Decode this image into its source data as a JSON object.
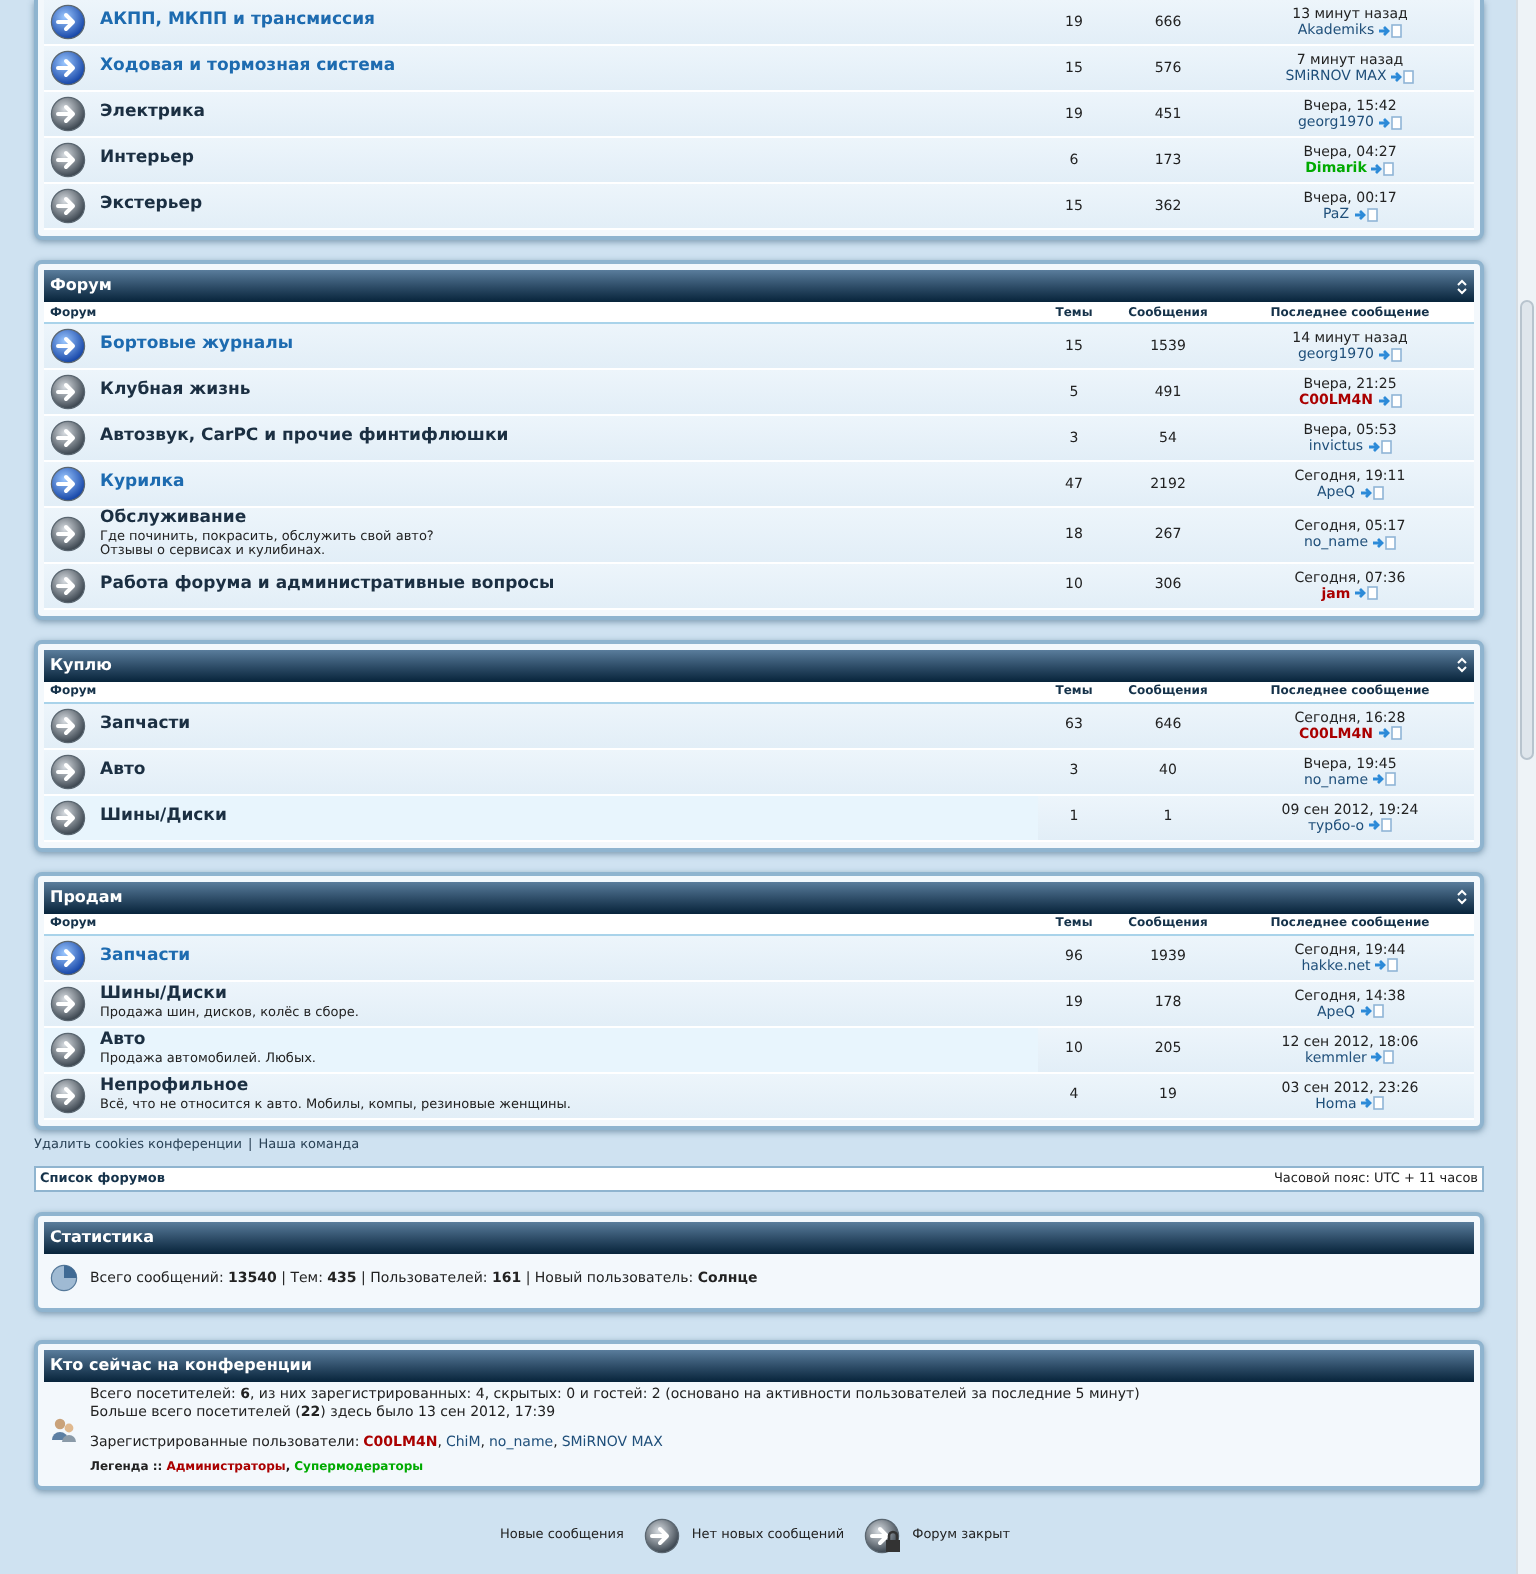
{
  "sections": [
    {
      "forums": [
        {
          "name": "АКПП, МКПП и трансмиссия",
          "unread": true,
          "hovered": false,
          "topics": "19",
          "posts": "666",
          "last_time": "13 минут назад",
          "last_user": {
            "name": "Akademiks",
            "color": "#1f4f7a"
          }
        },
        {
          "name": "Ходовая и тормозная система",
          "unread": true,
          "hovered": false,
          "topics": "15",
          "posts": "576",
          "last_time": "7 минут назад",
          "last_user": {
            "name": "SMiRNOV MAX",
            "color": "#1f4f7a"
          }
        },
        {
          "name": "Электрика",
          "unread": false,
          "hovered": false,
          "topics": "19",
          "posts": "451",
          "last_time": "Вчера, 15:42",
          "last_user": {
            "name": "georg1970",
            "color": "#1f4f7a"
          }
        },
        {
          "name": "Интерьер",
          "unread": false,
          "hovered": false,
          "topics": "6",
          "posts": "173",
          "last_time": "Вчера, 04:27",
          "last_user": {
            "name": "Dimarik",
            "color": "#00aa00"
          }
        },
        {
          "name": "Экстерьер",
          "unread": false,
          "hovered": false,
          "topics": "15",
          "posts": "362",
          "last_time": "Вчера, 00:17",
          "last_user": {
            "name": "PaZ",
            "color": "#1f4f7a"
          }
        }
      ]
    },
    {
      "title": "Форум",
      "columns": [
        "Форум",
        "Темы",
        "Сообщения",
        "Последнее сообщение"
      ],
      "forums": [
        {
          "name": "Бортовые журналы",
          "unread": true,
          "hovered": false,
          "topics": "15",
          "posts": "1539",
          "last_time": "14 минут назад",
          "last_user": {
            "name": "georg1970",
            "color": "#1f4f7a"
          }
        },
        {
          "name": "Клубная жизнь",
          "unread": false,
          "hovered": false,
          "topics": "5",
          "posts": "491",
          "last_time": "Вчера, 21:25",
          "last_user": {
            "name": "C00LM4N",
            "color": "#aa0000"
          }
        },
        {
          "name": "Автозвук, CarPC и прочие финтифлюшки",
          "unread": false,
          "hovered": false,
          "topics": "3",
          "posts": "54",
          "last_time": "Вчера, 05:53",
          "last_user": {
            "name": "invictus",
            "color": "#1f4f7a"
          }
        },
        {
          "name": "Курилка",
          "unread": true,
          "hovered": false,
          "topics": "47",
          "posts": "2192",
          "last_time": "Сегодня, 19:11",
          "last_user": {
            "name": "ApeQ",
            "color": "#1f4f7a"
          }
        },
        {
          "name": "Обслуживание",
          "description": "Где починить, покрасить, обслужить свой авто?\nОтзывы о сервисах и кулибинах.",
          "unread": false,
          "hovered": false,
          "topics": "18",
          "posts": "267",
          "last_time": "Сегодня, 05:17",
          "last_user": {
            "name": "no_name",
            "color": "#1f4f7a"
          }
        },
        {
          "name": "Работа форума и административные вопросы",
          "unread": false,
          "hovered": false,
          "topics": "10",
          "posts": "306",
          "last_time": "Сегодня, 07:36",
          "last_user": {
            "name": "jam",
            "color": "#aa0000"
          }
        }
      ]
    },
    {
      "title": "Куплю",
      "columns": [
        "Форум",
        "Темы",
        "Сообщения",
        "Последнее сообщение"
      ],
      "forums": [
        {
          "name": "Запчасти",
          "unread": false,
          "hovered": false,
          "topics": "63",
          "posts": "646",
          "last_time": "Сегодня, 16:28",
          "last_user": {
            "name": "C00LM4N",
            "color": "#aa0000"
          }
        },
        {
          "name": "Авто",
          "unread": false,
          "hovered": false,
          "topics": "3",
          "posts": "40",
          "last_time": "Вчера, 19:45",
          "last_user": {
            "name": "no_name",
            "color": "#1f4f7a"
          }
        },
        {
          "name": "Шины/Диски",
          "unread": false,
          "hovered": true,
          "topics": "1",
          "posts": "1",
          "last_time": "09 сен 2012, 19:24",
          "last_user": {
            "name": "турбо-о",
            "color": "#1f4f7a"
          }
        }
      ]
    },
    {
      "title": "Продам",
      "columns": [
        "Форум",
        "Темы",
        "Сообщения",
        "Последнее сообщение"
      ],
      "forums": [
        {
          "name": "Запчасти",
          "unread": true,
          "hovered": false,
          "topics": "96",
          "posts": "1939",
          "last_time": "Сегодня, 19:44",
          "last_user": {
            "name": "hakke.net",
            "color": "#1f4f7a"
          }
        },
        {
          "name": "Шины/Диски",
          "description": "Продажа шин, дисков, колёс в сборе.",
          "unread": false,
          "hovered": false,
          "topics": "19",
          "posts": "178",
          "last_time": "Сегодня, 14:38",
          "last_user": {
            "name": "ApeQ",
            "color": "#1f4f7a"
          }
        },
        {
          "name": "Авто",
          "description": "Продажа автомобилей. Любых.",
          "unread": false,
          "hovered": true,
          "topics": "10",
          "posts": "205",
          "last_time": "12 сен 2012, 18:06",
          "last_user": {
            "name": "kemmler",
            "color": "#1f4f7a"
          }
        },
        {
          "name": "Непрофильное",
          "description": "Всё, что не относится к авто. Мобилы, компы, резиновые женщины.",
          "unread": false,
          "hovered": false,
          "topics": "4",
          "posts": "19",
          "last_time": "03 сен 2012, 23:26",
          "last_user": {
            "name": "Homa",
            "color": "#1f4f7a"
          }
        }
      ]
    }
  ],
  "footer_links": [
    "Удалить cookies конференции",
    "|",
    "Наша команда"
  ],
  "nav_bar": {
    "label": "Список форумов",
    "timezone": "Часовой пояс: UTC + 11 часов"
  },
  "statistics": {
    "title": "Статистика",
    "text": "Всего сообщений: **13540** | Тем: **435** | Пользователей: **161** | Новый пользователь: **Солнце**"
  },
  "online": {
    "title": "Кто сейчас на конференции",
    "lines": [
      "Всего посетителей: **6**, из них зарегистрированных: 4, скрытых: 0 и гостей: 2 (основано на активности пользователей за последние 5 минут)",
      "Больше всего посетителей (**22**) здесь было 13 сен 2012, 17:39"
    ],
    "registered_label": "Зарегистрированные пользователи:",
    "users": [
      {
        "name": "C00LM4N",
        "color": "#aa0000",
        "separator": ","
      },
      {
        "name": "ChiM",
        "color": "#1f4f7a",
        "separator": ","
      },
      {
        "name": "no_name",
        "color": "#1f4f7a",
        "separator": ","
      },
      {
        "name": "SMiRNOV MAX",
        "color": "#1f4f7a"
      }
    ],
    "legend_label": "Легенда ::",
    "groups": [
      {
        "name": "Администраторы",
        "color": "#aa0000",
        "separator": ","
      },
      {
        "name": "Супермодераторы",
        "color": "#00aa00"
      }
    ]
  },
  "icon_legend": [
    {
      "label": "Новые сообщения",
      "kind": "new"
    },
    {
      "label": "Нет новых сообщений",
      "kind": "read"
    },
    {
      "label": "Форум закрыт",
      "kind": "locked"
    }
  ]
}
